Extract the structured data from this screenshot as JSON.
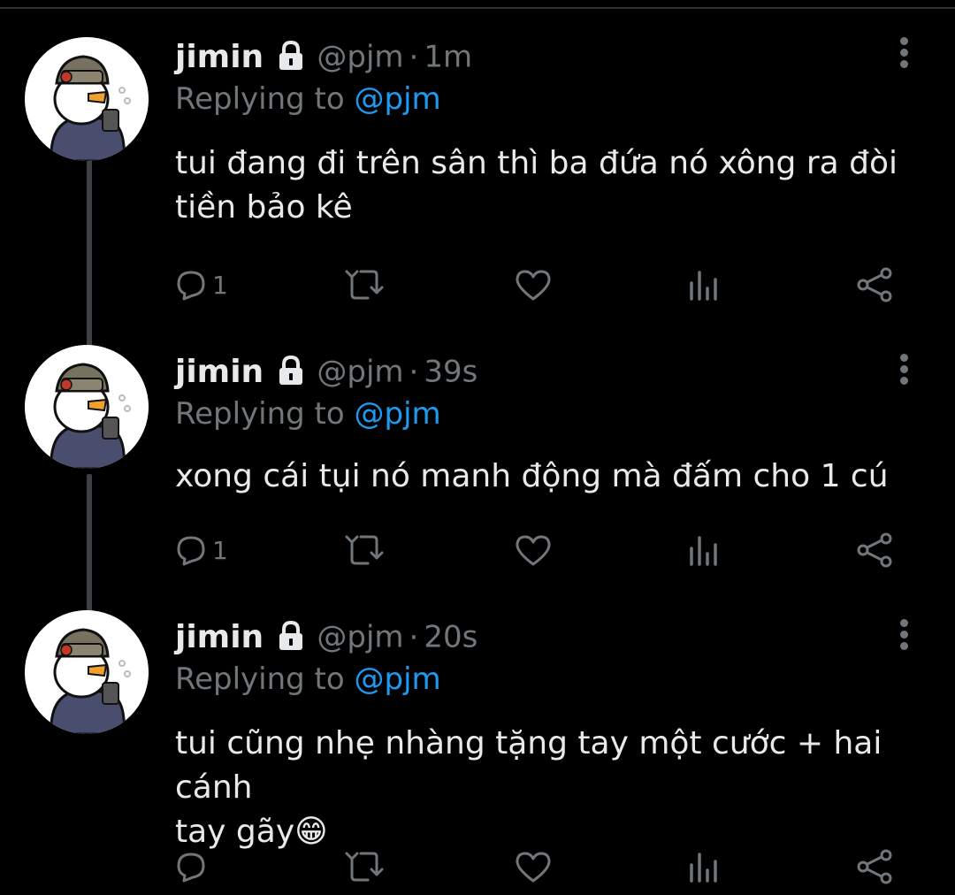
{
  "tweets": [
    {
      "name": "jimin",
      "handle": "@pjm",
      "separator": "·",
      "time": "1m",
      "replying_prefix": "Replying to",
      "replying_to": "@pjm",
      "text_lines": [
        "tui đang đi trên sân thì ba đứa nó xông ra đòi",
        "tiền bảo kê"
      ],
      "reply_count": "1",
      "lock_icon": "lock-icon",
      "avatar_icon": "duck-avatar"
    },
    {
      "name": "jimin",
      "handle": "@pjm",
      "separator": "·",
      "time": "39s",
      "replying_prefix": "Replying to",
      "replying_to": "@pjm",
      "text_lines": [
        "xong cái tụi nó manh động mà đấm cho 1 cú"
      ],
      "reply_count": "1",
      "lock_icon": "lock-icon",
      "avatar_icon": "duck-avatar"
    },
    {
      "name": "jimin",
      "handle": "@pjm",
      "separator": "·",
      "time": "20s",
      "replying_prefix": "Replying to",
      "replying_to": "@pjm",
      "text_lines": [
        "tui cũng nhẹ nhàng tặng tay một cước + hai cánh",
        "tay gãy"
      ],
      "emoji": "😁",
      "reply_count": "",
      "lock_icon": "lock-icon",
      "avatar_icon": "duck-avatar"
    }
  ],
  "colors": {
    "background": "#000000",
    "text": "#e7e9ea",
    "muted": "#71767b",
    "mention": "#1d9bf0",
    "thread_line": "#3e4144"
  },
  "action_icons": [
    "reply-icon",
    "retweet-icon",
    "like-icon",
    "analytics-icon",
    "share-icon"
  ]
}
